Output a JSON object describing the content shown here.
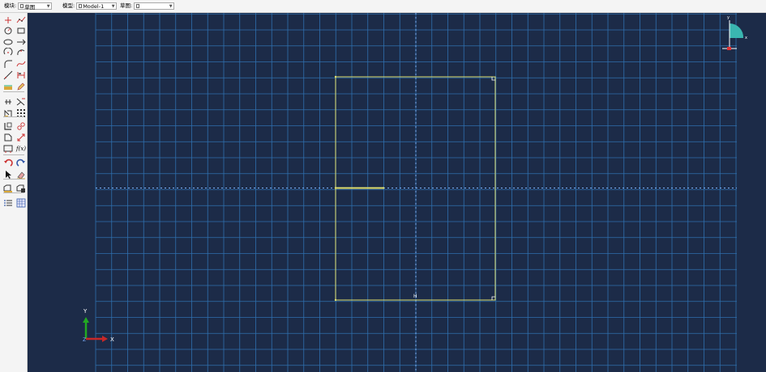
{
  "toolbar": {
    "fields": [
      {
        "label": "模块:",
        "value": "草图"
      },
      {
        "label": "模型:",
        "value": "Model-1"
      },
      {
        "label": "草图:",
        "value": ""
      }
    ]
  },
  "toolbox": {
    "rows": [
      [
        "point-icon",
        "spline-points-icon"
      ],
      [
        "circle-icon",
        "rectangle-icon"
      ],
      [
        "ellipse-icon",
        "line-arrows-icon"
      ],
      [
        "arc-center-icon",
        "arc-three-point-icon"
      ],
      [
        "fillet-icon",
        "spline-icon"
      ],
      [
        "construction-line-icon",
        "dimension-icon"
      ],
      [
        "offset-icon",
        "edit-icon"
      ],
      [
        "constraint-icon",
        "auto-dimension-icon"
      ],
      [
        "mirror-icon",
        "pattern-icon"
      ],
      [
        "copy-icon",
        "scale-icon"
      ],
      [
        "move-icon",
        "stretch-icon"
      ],
      [
        "parameter-icon",
        "fx-icon"
      ],
      [
        "undo-icon",
        "redo-icon"
      ],
      [
        "select-icon",
        "erase-icon"
      ],
      [
        "sketch-options-icon",
        "sketch-done-icon"
      ],
      [
        "list-icon",
        "grid-icon"
      ]
    ],
    "fx_label": "f(x)"
  },
  "viewport": {
    "sketch_label": "H",
    "axis_y_label": "Y",
    "axis_x_label": "X",
    "axis_z_label": "Z",
    "compass_y_label": "y",
    "compass_x_label": "x",
    "colors": {
      "background": "#1c2b48",
      "grid": "#2f6fae",
      "sketch": "#e1e070",
      "axis_x": "#c82828",
      "axis_y": "#22aa22",
      "compass": "#3ab6b0"
    }
  }
}
